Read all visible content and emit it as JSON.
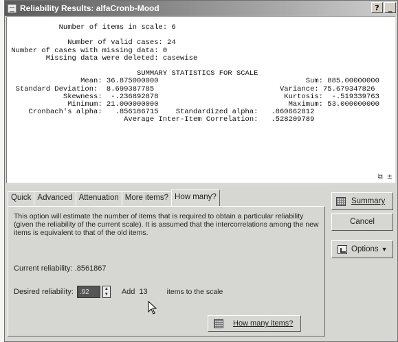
{
  "window": {
    "title": "Reliability Results: alfaCronb-Mood",
    "help_btn": "?",
    "min_btn": "_"
  },
  "output": {
    "lines": [
      "            Number of items in scale: 6",
      "",
      "              Number of valid cases: 24",
      " Number of cases with missing data: 0",
      "         Missing data were deleted: casewise",
      "",
      "                              SUMMARY STATISTICS FOR SCALE",
      "                 Mean: 36.875000000                                  Sum: 885.00000000",
      "  Standard Deviation:  8.699387785                             Variance: 75.679347826",
      "             Skewness:  -.236892878                             Kurtosis:  -.519339763",
      "              Minimum: 21.000000000                              Maximum: 53.000000000",
      "     Cronbach's alpha:   .856186715    Standardized alpha:   .860662812",
      "                           Average Inter-Item Correlation:   .528209789"
    ],
    "corner_icons": [
      "copy-icon",
      "pin-icon"
    ]
  },
  "tabs": [
    {
      "label": "Quick"
    },
    {
      "label": "Advanced"
    },
    {
      "label": "Attenuation"
    },
    {
      "label": "More items?"
    },
    {
      "label": "How many?"
    }
  ],
  "howmany": {
    "description": "This option will estimate the number of items that is required to obtain a particular reliability (given the reliability of the current scale). It is assumed that the intercorrelations among the new items is equivalent to that of the old items.",
    "current_label": "Current reliability:",
    "current_value": ".8561867",
    "desired_label": "Desired reliability:",
    "desired_value": ".92",
    "add_label": "Add",
    "add_value": "13",
    "scale_label": "items to the scale",
    "button_label": "How many items?"
  },
  "side_buttons": {
    "summary": "Summary",
    "cancel": "Cancel",
    "options": "Options"
  }
}
